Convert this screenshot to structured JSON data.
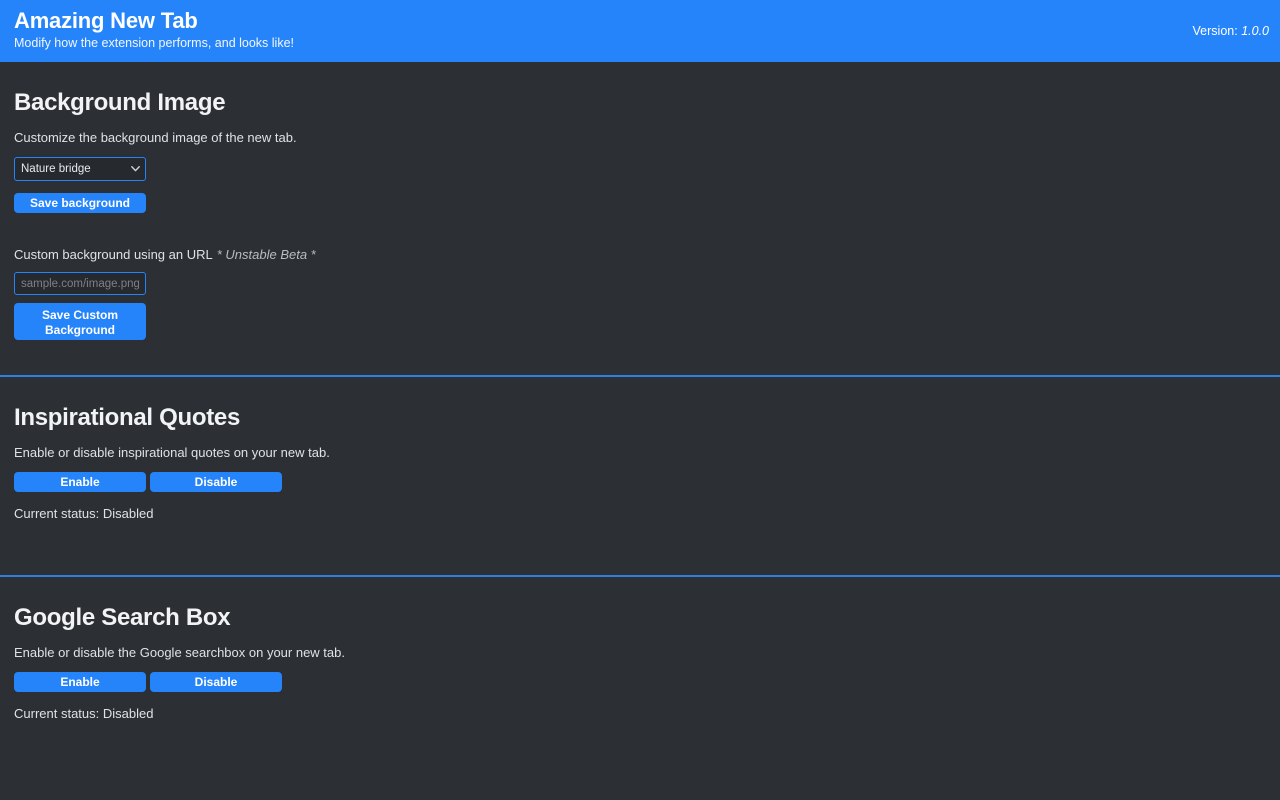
{
  "header": {
    "title": "Amazing New Tab",
    "subtitle": "Modify how the extension performs, and looks like!",
    "version_label": "Version:",
    "version_value": "1.0.0",
    "bg_color": "#2684fb"
  },
  "theme": {
    "page_bg": "#2c2f34",
    "accent": "#2684fb",
    "text": "#e8eaed",
    "muted_text": "#dfe1e5",
    "control_bg": "#26292e",
    "placeholder": "#7d8288"
  },
  "sections": {
    "background_image": {
      "title": "Background Image",
      "description": "Customize the background image of the new tab.",
      "select": {
        "selected": "Nature bridge",
        "options": [
          "Nature bridge"
        ],
        "icon": "chevron-down-icon"
      },
      "save_button": "Save background",
      "custom_url": {
        "label": "Custom background using an URL",
        "beta_note": "* Unstable Beta *",
        "placeholder": "sample.com/image.png",
        "value": "",
        "save_button": "Save Custom Background"
      }
    },
    "inspirational_quotes": {
      "title": "Inspirational Quotes",
      "description": "Enable or disable inspirational quotes on your new tab.",
      "enable_button": "Enable",
      "disable_button": "Disable",
      "status": "Current status: Disabled"
    },
    "google_search_box": {
      "title": "Google Search Box",
      "description": "Enable or disable the Google searchbox on your new tab.",
      "enable_button": "Enable",
      "disable_button": "Disable",
      "status": "Current status: Disabled"
    }
  }
}
